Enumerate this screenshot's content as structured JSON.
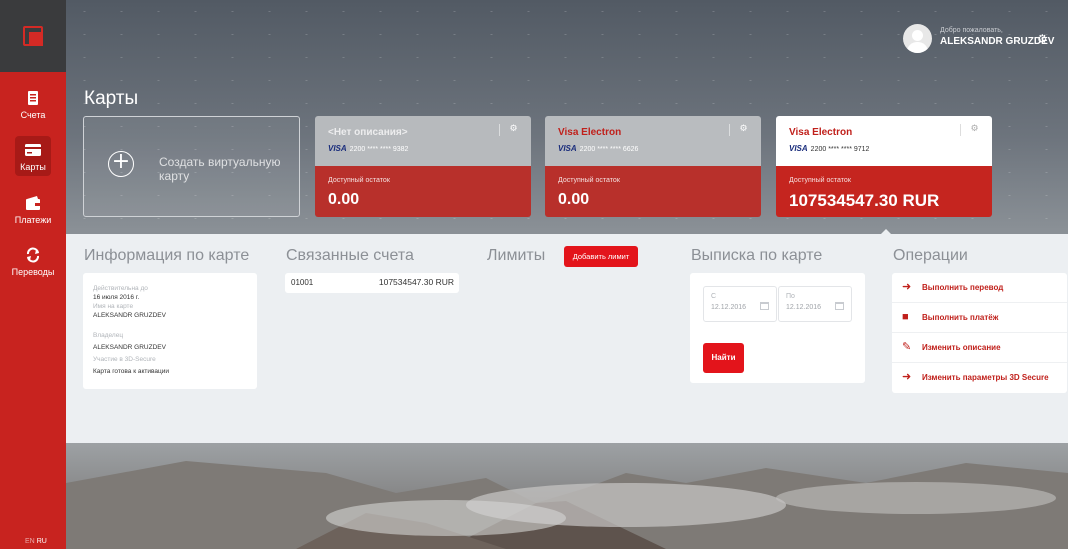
{
  "sidebar": {
    "items": [
      {
        "label": "Счета",
        "icon": "accounts-icon"
      },
      {
        "label": "Карты",
        "icon": "cards-icon",
        "active": true
      },
      {
        "label": "Платежи",
        "icon": "wallet-icon"
      },
      {
        "label": "Переводы",
        "icon": "transfer-icon"
      }
    ],
    "lang_en": "EN",
    "lang_ru": "RU"
  },
  "header": {
    "welcome": "Добро пожаловать,",
    "username": "ALEKSANDR GRUZDEV"
  },
  "page": {
    "title": "Карты"
  },
  "create_card": {
    "label": "Создать виртуальную карту"
  },
  "cards": [
    {
      "name": "<Нет описания>",
      "brand": "VISA",
      "number": "2200 **** **** 9382",
      "available_label": "Доступный остаток",
      "amount": "0.00"
    },
    {
      "name": "Visa Electron",
      "brand": "VISA",
      "number": "2200 **** **** 6626",
      "available_label": "Доступный остаток",
      "amount": "0.00"
    },
    {
      "name": "Visa Electron",
      "brand": "VISA",
      "number": "2200 **** **** 9712",
      "available_label": "Доступный остаток",
      "amount": "107534547.30 RUR"
    }
  ],
  "card_info": {
    "title": "Информация по карте",
    "rows": [
      {
        "key": "Действительна до",
        "value": "16 июля 2016 г."
      },
      {
        "key": "Имя на карте",
        "value": "ALEKSANDR GRUZDEV"
      },
      {
        "key": "Владелец",
        "value": "ALEKSANDR GRUZDEV"
      },
      {
        "key": "Участие в 3D-Secure",
        "value": "Карта готова к активации"
      }
    ]
  },
  "linked_accounts": {
    "title": "Связанные счета",
    "items": [
      {
        "account": "01001",
        "balance": "107534547.30 RUR"
      }
    ]
  },
  "limits": {
    "title": "Лимиты",
    "add_button": "Добавить лимит"
  },
  "statement": {
    "title": "Выписка по карте",
    "from_label": "С",
    "from_value": "12.12.2016",
    "to_label": "По",
    "to_value": "12.12.2016",
    "find_button": "Найти"
  },
  "operations": {
    "title": "Операции",
    "items": [
      {
        "label": "Выполнить перевод",
        "icon": "arrow-right-icon"
      },
      {
        "label": "Выполнить платёж",
        "icon": "wallet-icon"
      },
      {
        "label": "Изменить описание",
        "icon": "pencil-icon"
      },
      {
        "label": "Изменить параметры 3D Secure",
        "icon": "arrow-right-icon"
      }
    ]
  },
  "colors": {
    "accent": "#c8231f",
    "button": "#e3141b",
    "sidebar_dark": "#3a3b3d"
  }
}
